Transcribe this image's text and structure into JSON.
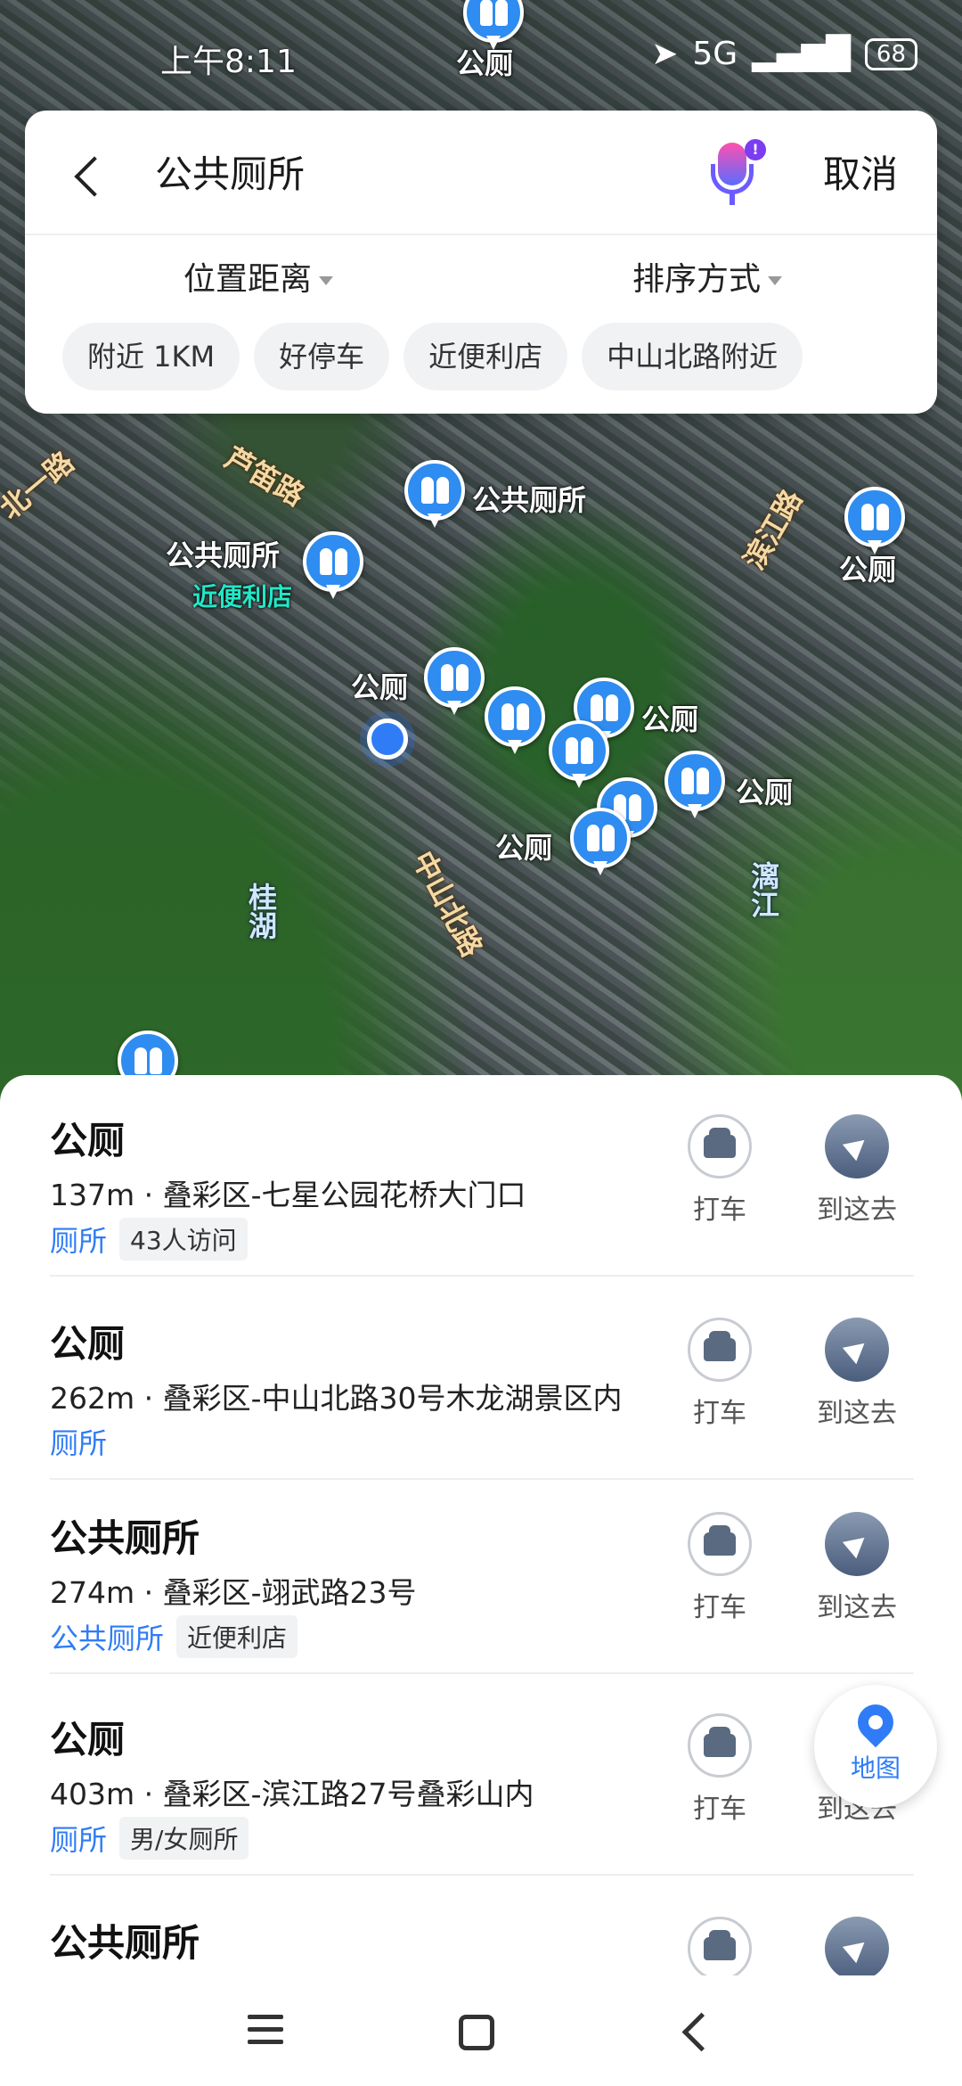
{
  "status_bar": {
    "time": "上午8:11",
    "network": "5G",
    "battery": "68"
  },
  "search": {
    "query": "公共厕所",
    "cancel_label": "取消",
    "filters": {
      "distance": "位置距离",
      "sort": "排序方式"
    },
    "chips": [
      "附近 1KM",
      "好停车",
      "近便利店",
      "中山北路附近"
    ]
  },
  "map": {
    "labels": {
      "l1": "公厕",
      "l2": "公共厕所",
      "l3": "公共厕所",
      "l4": "近便利店",
      "l5": "公厕",
      "l6": "公厕",
      "l7": "公厕",
      "l8": "公厕",
      "l9": "公厕",
      "road1": "芦笛路",
      "road2": "中山北路",
      "road3": "北一路",
      "road4": "滨江路",
      "water1": "桂湖",
      "water2": "漓江"
    }
  },
  "results": [
    {
      "name": "公厕",
      "address": "137m · 叠彩区-七星公园花桥大门口",
      "category": "厕所",
      "tag": "43人访问",
      "taxi": "打车",
      "go": "到这去"
    },
    {
      "name": "公厕",
      "address": "262m · 叠彩区-中山北路30号木龙湖景区内",
      "category": "厕所",
      "tag": "",
      "taxi": "打车",
      "go": "到这去"
    },
    {
      "name": "公共厕所",
      "address": "274m · 叠彩区-翊武路23号",
      "category": "公共厕所",
      "tag": "近便利店",
      "taxi": "打车",
      "go": "到这去"
    },
    {
      "name": "公厕",
      "address": "403m · 叠彩区-滨江路27号叠彩山内",
      "category": "厕所",
      "tag": "男/女厕所",
      "taxi": "打车",
      "go": "到这去"
    },
    {
      "name": "公共厕所",
      "address": "",
      "category": "",
      "tag": "",
      "taxi": "",
      "go": ""
    }
  ],
  "map_button": {
    "label": "地图"
  },
  "colors": {
    "accent": "#2f7cf6",
    "pin": "#2f8cf0"
  }
}
